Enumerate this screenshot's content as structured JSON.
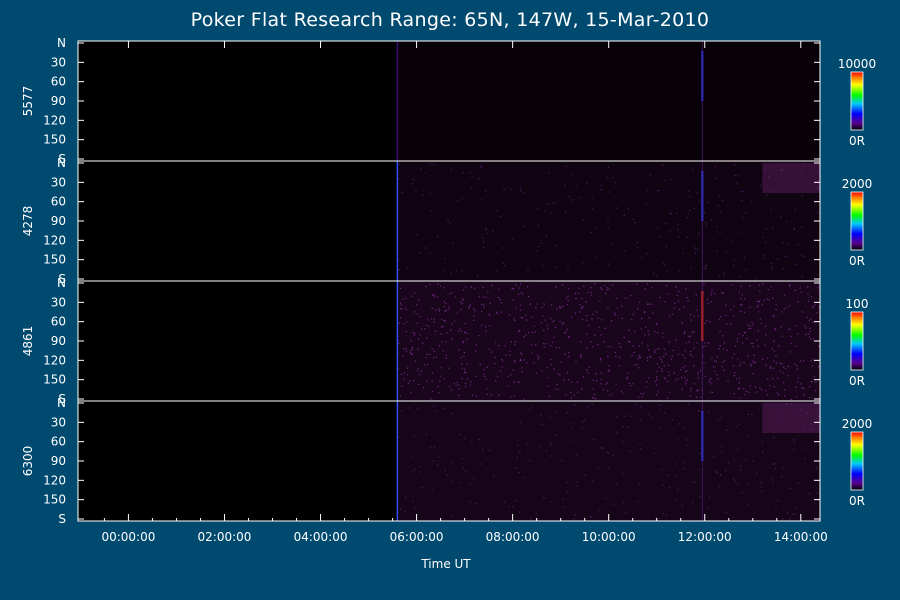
{
  "title": "Poker Flat Research Range: 65N, 147W, 15-Mar-2010",
  "chart_data": {
    "type": "heatmap",
    "title": "Poker Flat Research Range: 65N, 147W, 15-Mar-2010",
    "xlabel": "Time UT",
    "x_ticks": [
      "00:00:00",
      "02:00:00",
      "04:00:00",
      "06:00:00",
      "08:00:00",
      "10:00:00",
      "12:00:00",
      "14:00:00"
    ],
    "x_range_hours": [
      -1.05,
      14.4
    ],
    "y_ticks": [
      "N",
      "30",
      "60",
      "90",
      "120",
      "150",
      "S"
    ],
    "y_range_deg": [
      0,
      180
    ],
    "panels": [
      {
        "name": "5577",
        "cbar_max": "10000",
        "cbar_min": "0R"
      },
      {
        "name": "4278",
        "cbar_max": "2000",
        "cbar_min": "0R"
      },
      {
        "name": "4861",
        "cbar_max": "100",
        "cbar_min": "0R"
      },
      {
        "name": "6300",
        "cbar_max": "2000",
        "cbar_min": "0R"
      }
    ],
    "data_start_hour": 5.6,
    "spike_hours": [
      5.6,
      11.95
    ]
  },
  "colors": {
    "background": "#004a70",
    "plot_bg": "#000000",
    "axis": "#ffffff",
    "noise": "#3a0a40"
  }
}
